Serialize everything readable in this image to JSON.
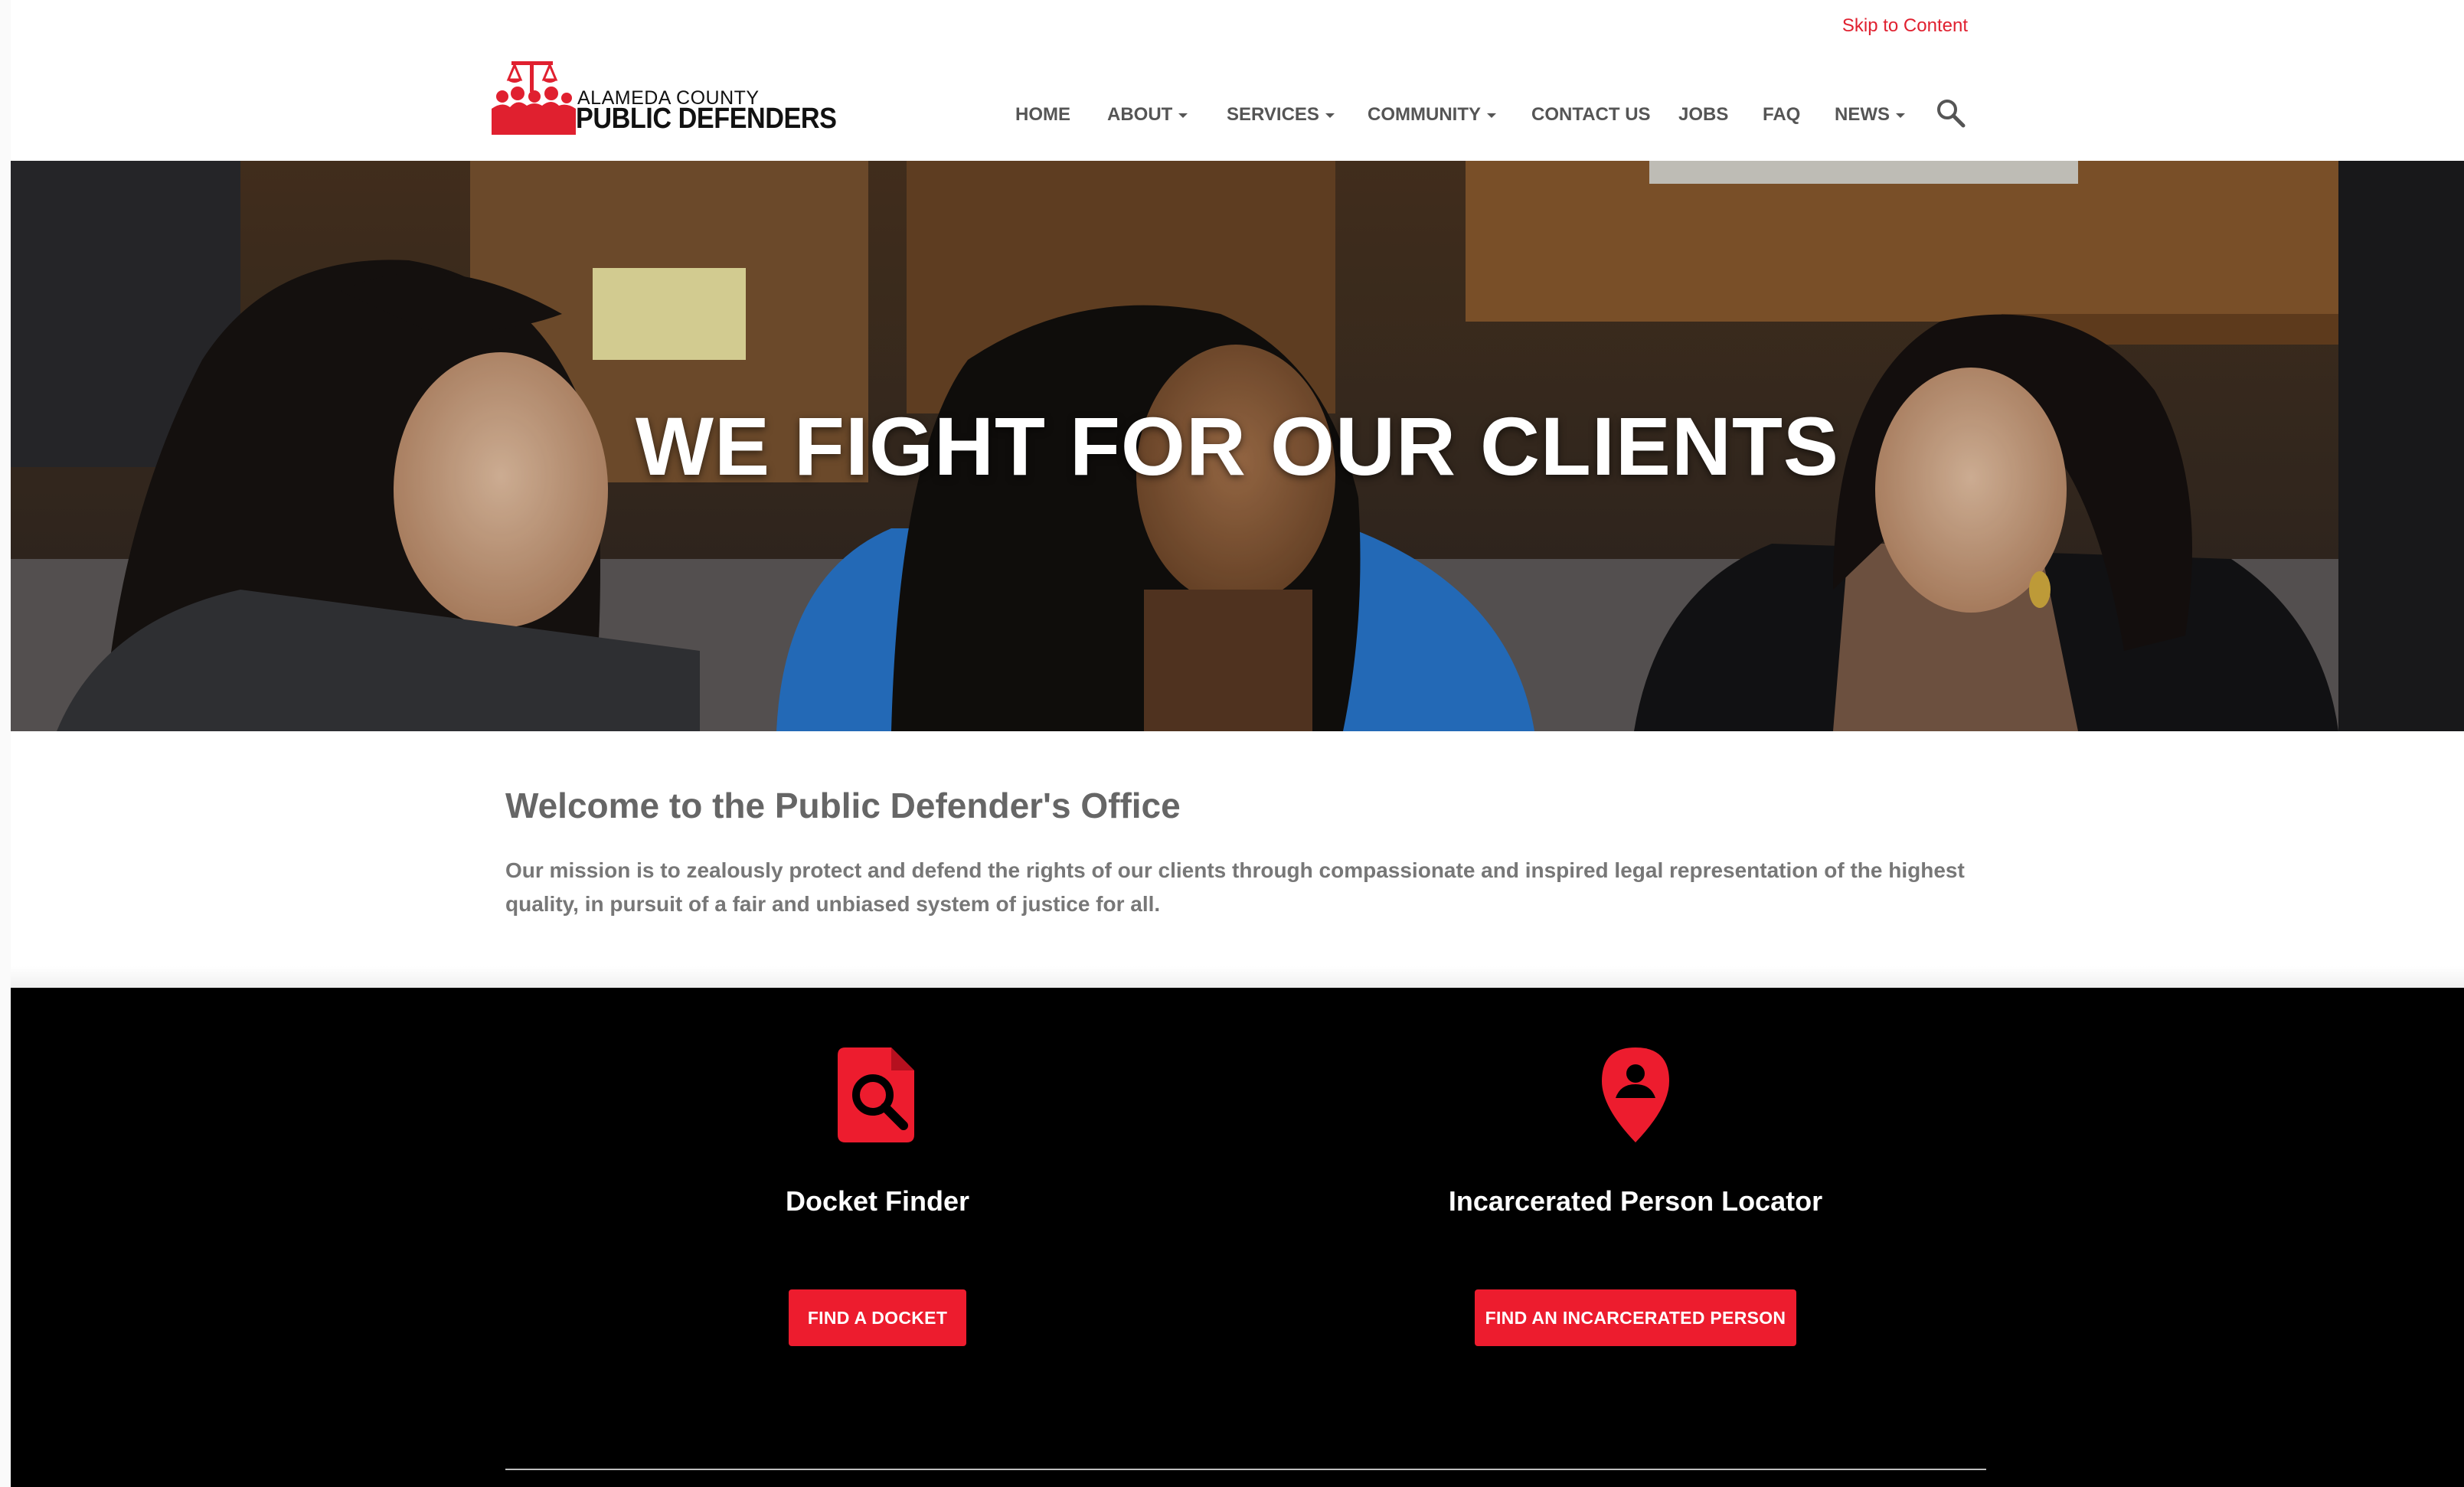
{
  "header": {
    "skip_link": "Skip to Content",
    "logo": {
      "line1": "ALAMEDA COUNTY",
      "line2": "PUBLIC DEFENDERS",
      "brand_color": "#e0202f"
    },
    "nav": [
      {
        "label": "HOME",
        "dropdown": false
      },
      {
        "label": "ABOUT",
        "dropdown": true
      },
      {
        "label": "SERVICES",
        "dropdown": true
      },
      {
        "label": "COMMUNITY",
        "dropdown": true
      },
      {
        "label": "CONTACT US",
        "dropdown": false
      },
      {
        "label": "JOBS",
        "dropdown": false
      },
      {
        "label": "FAQ",
        "dropdown": false
      },
      {
        "label": "NEWS",
        "dropdown": true
      }
    ],
    "search_icon": "search-icon"
  },
  "hero": {
    "title": "WE FIGHT FOR OUR CLIENTS"
  },
  "welcome": {
    "title": "Welcome to the Public Defender's Office",
    "text": "Our mission is to zealously protect and defend the rights of our clients through compassionate and inspired legal representation of the highest quality, in pursuit of a fair and unbiased system of justice for all."
  },
  "tools": [
    {
      "icon": "document-search-icon",
      "title": "Docket Finder",
      "button": "FIND A DOCKET"
    },
    {
      "icon": "person-location-pin-icon",
      "title": "Incarcerated Person Locator",
      "button": "FIND AN INCARCERATED PERSON"
    }
  ],
  "colors": {
    "accent": "#ed1c2e",
    "band": "#000000",
    "nav_text": "#555555"
  }
}
